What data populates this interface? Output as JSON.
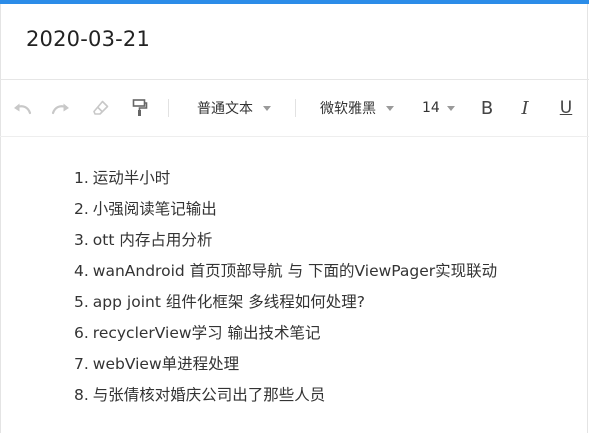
{
  "document": {
    "title": "2020-03-21"
  },
  "toolbar": {
    "icons": {
      "undo": "undo-icon",
      "redo": "redo-icon",
      "clear_format": "eraser-icon",
      "format_painter": "format-painter-icon"
    },
    "paragraph_style": "普通文本",
    "font_family": "微软雅黑",
    "font_size": "14",
    "bold_label": "B",
    "italic_label": "I",
    "underline_label": "U"
  },
  "list": {
    "items": [
      {
        "number": "1.",
        "text": "运动半小时"
      },
      {
        "number": "2.",
        "text": "小强阅读笔记输出"
      },
      {
        "number": "3.",
        "text": "ott 内存占用分析"
      },
      {
        "number": "4.",
        "text": "wanAndroid 首页顶部导航 与 下面的ViewPager实现联动"
      },
      {
        "number": "5.",
        "text": "app joint 组件化框架 多线程如何处理?"
      },
      {
        "number": "6.",
        "text": "recyclerView学习 输出技术笔记"
      },
      {
        "number": "7.",
        "text": "webView单进程处理"
      },
      {
        "number": "8.",
        "text": "与张倩核对婚庆公司出了那些人员"
      }
    ]
  },
  "colors": {
    "accent": "#2b8ce8",
    "text": "#333333",
    "icon_disabled": "#c8c8c8"
  }
}
